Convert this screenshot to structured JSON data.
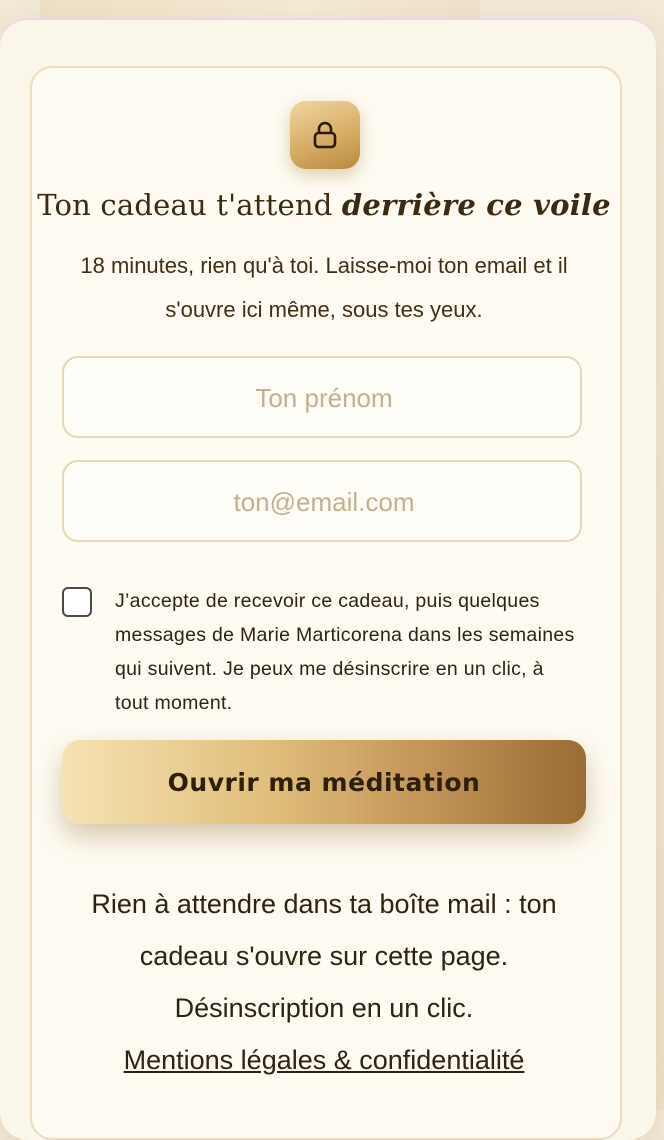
{
  "form": {
    "title_plain": "Ton cadeau t'attend ",
    "title_emphasis": "derrière ce voile",
    "subtitle": "18 minutes, rien qu'à toi. Laisse-moi ton email et il s'ouvre ici même, sous tes yeux.",
    "firstname_placeholder": "Ton prénom",
    "email_placeholder": "ton@email.com",
    "consent_text": "J’accepte de recevoir ce cadeau, puis quelques messages de Marie Marticorena dans les semaines qui suivent. Je peux me désinscrire en un clic, à tout moment.",
    "submit_label": "Ouvrir ma méditation"
  },
  "footer": {
    "note": "Rien à attendre dans ta boîte mail : ton cadeau s'ouvre sur cette page. Désinscription en un clic.",
    "legal_link": "Mentions légales & confidentialité"
  },
  "icons": {
    "lock": "lock-icon"
  },
  "colors": {
    "accent_gold": "#d7ad66",
    "text_dark": "#3a2a12",
    "card_bg": "#fefbf2"
  }
}
